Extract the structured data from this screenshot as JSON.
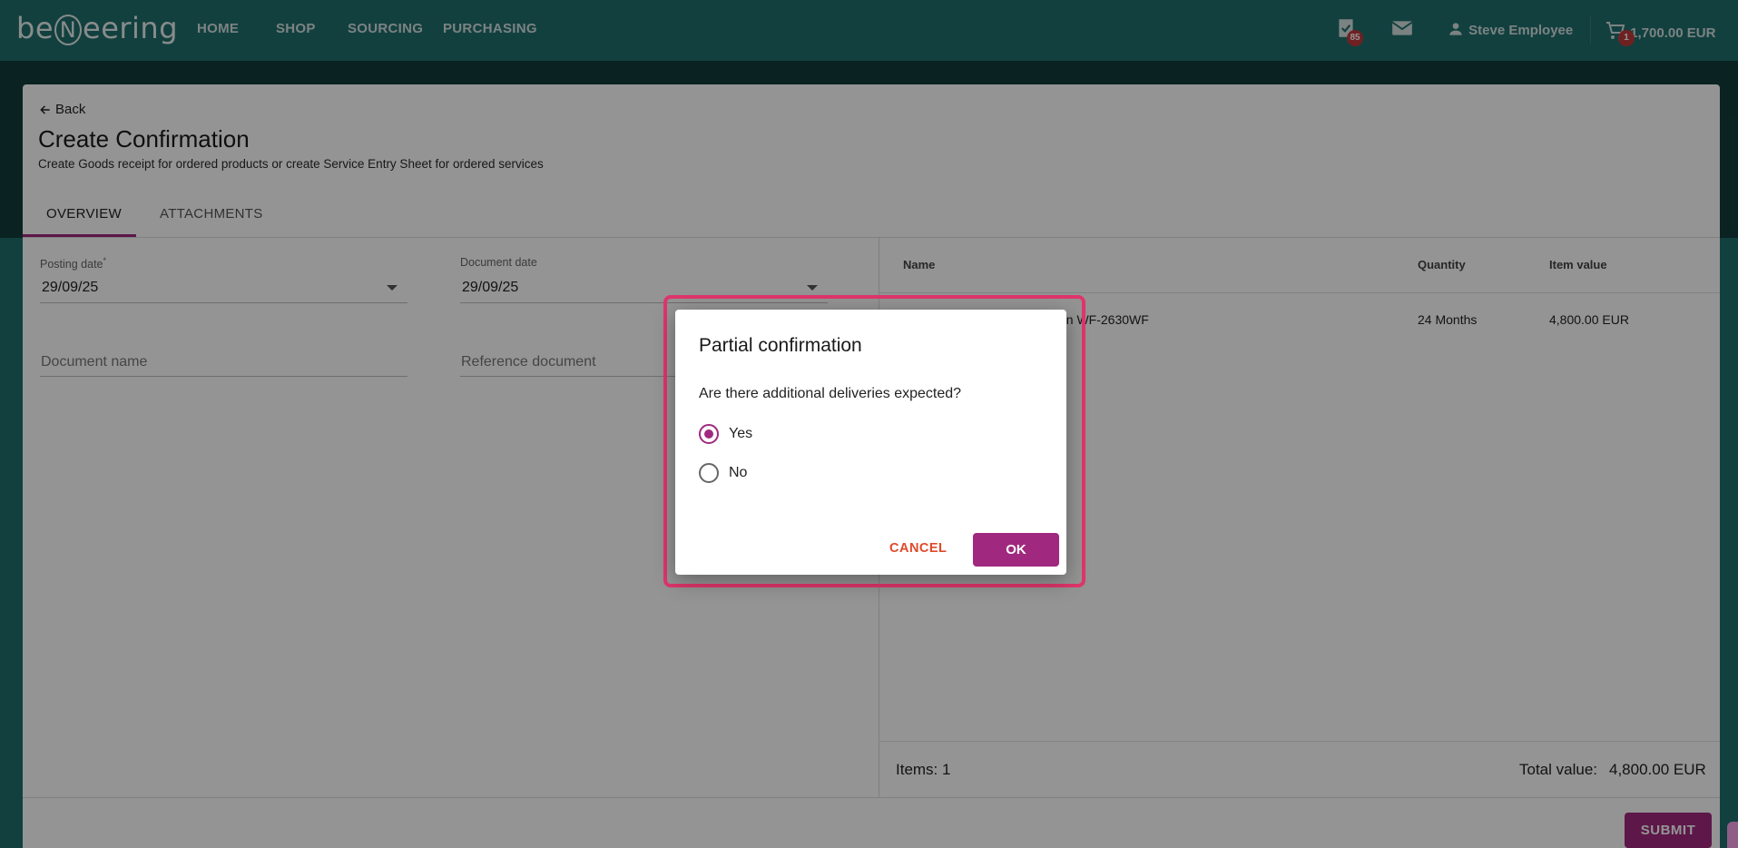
{
  "header": {
    "logo": {
      "pre": "be",
      "mid": "N",
      "post": "eering"
    },
    "nav": [
      "HOME",
      "SHOP",
      "SOURCING",
      "PURCHASING"
    ],
    "tasks_badge": "85",
    "user_name": "Steve Employee",
    "cart_badge": "1",
    "cart_total": "1,700.00 EUR"
  },
  "page": {
    "back_label": "Back",
    "title": "Create Confirmation",
    "subtitle": "Create Goods receipt for ordered products or create Service Entry Sheet for ordered services",
    "tabs": [
      "OVERVIEW",
      "ATTACHMENTS"
    ],
    "active_tab": "OVERVIEW"
  },
  "form": {
    "posting_date_label": "Posting date",
    "posting_date_required": "*",
    "posting_date_value": "29/09/25",
    "document_date_label": "Document date",
    "document_date_value": "29/09/25",
    "document_name_placeholder": "Document name",
    "reference_document_placeholder": "Reference document"
  },
  "items_table": {
    "columns": [
      "Name",
      "Quantity",
      "Item value"
    ],
    "rows": [
      {
        "name_visible": "on WF-2630WF",
        "quantity": "24 Months",
        "value": "4,800.00 EUR"
      }
    ],
    "items_count_label": "Items: 1",
    "total_label": "Total value:",
    "total_value": "4,800.00 EUR"
  },
  "submit_label": "SUBMIT",
  "dialog": {
    "title": "Partial confirmation",
    "question": "Are there additional deliveries expected?",
    "options": [
      {
        "label": "Yes",
        "checked": true
      },
      {
        "label": "No",
        "checked": false
      }
    ],
    "cancel_label": "CANCEL",
    "ok_label": "OK"
  },
  "colors": {
    "header_bg": "#1f6f6d",
    "accent": "#a0297f",
    "cancel_text": "#e0492a",
    "highlight_border": "#e0356c"
  }
}
